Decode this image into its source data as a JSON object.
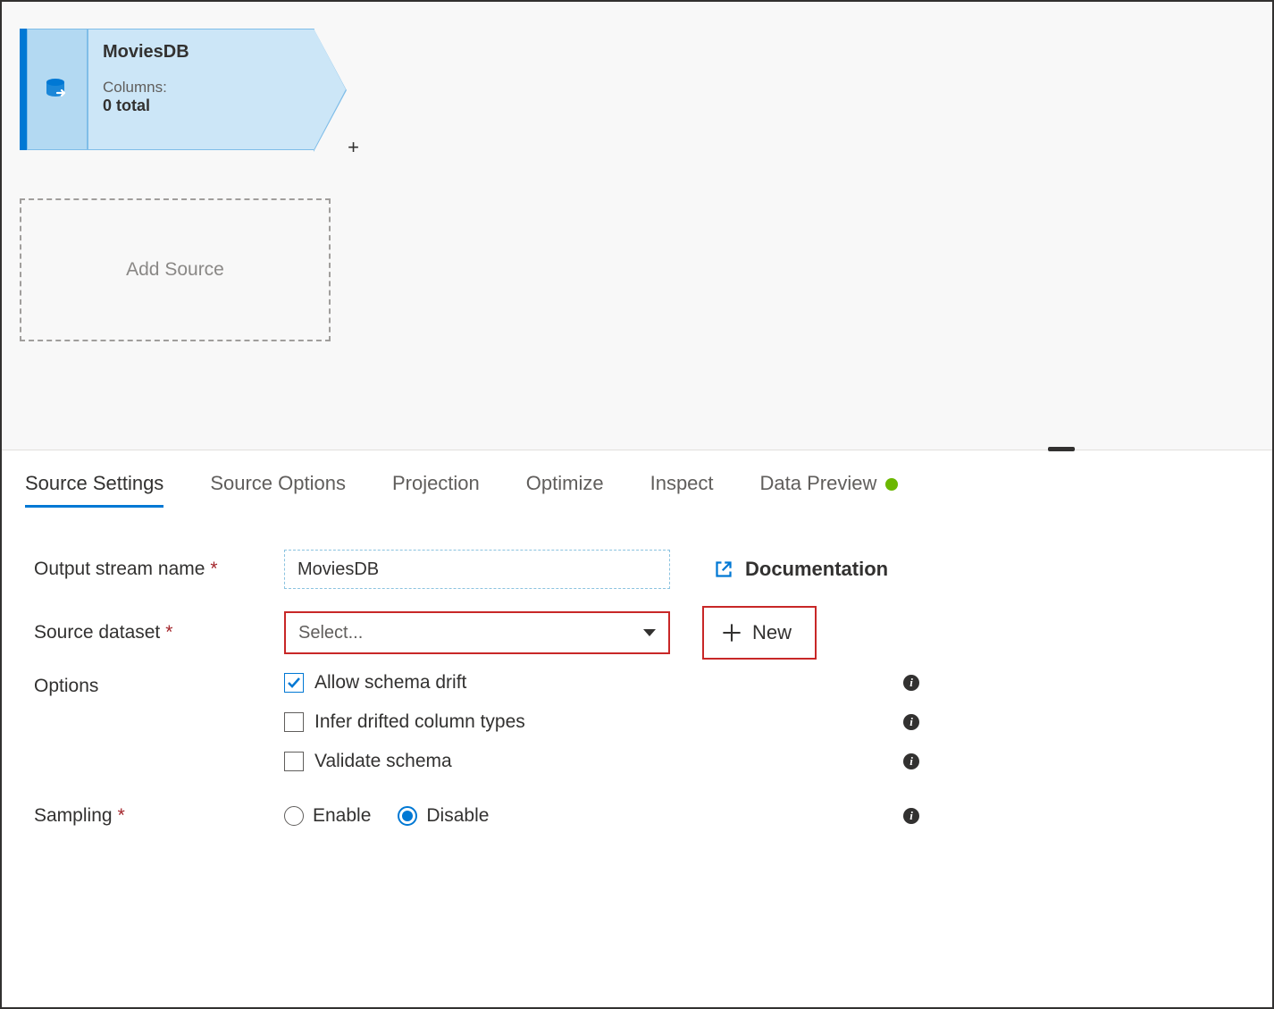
{
  "canvas": {
    "node": {
      "title": "MoviesDB",
      "columns_label": "Columns:",
      "columns_value": "0 total"
    },
    "add_source_label": "Add Source",
    "plus_label": "+"
  },
  "tabs": [
    {
      "label": "Source Settings",
      "active": true
    },
    {
      "label": "Source Options",
      "active": false
    },
    {
      "label": "Projection",
      "active": false
    },
    {
      "label": "Optimize",
      "active": false
    },
    {
      "label": "Inspect",
      "active": false
    },
    {
      "label": "Data Preview",
      "active": false,
      "status": true
    }
  ],
  "form": {
    "output_stream_label": "Output stream name",
    "output_stream_value": "MoviesDB",
    "source_dataset_label": "Source dataset",
    "select_placeholder": "Select...",
    "new_button_label": "New",
    "documentation_label": "Documentation",
    "options_label": "Options",
    "options": {
      "allow_schema_drift": "Allow schema drift",
      "infer_drifted": "Infer drifted column types",
      "validate_schema": "Validate schema"
    },
    "sampling_label": "Sampling",
    "sampling_enable": "Enable",
    "sampling_disable": "Disable"
  }
}
